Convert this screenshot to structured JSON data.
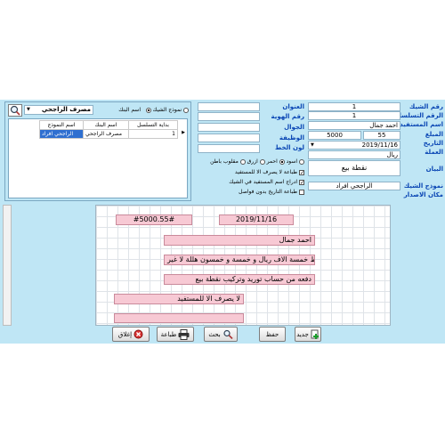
{
  "form": {
    "labels": {
      "cheque_no": "رقم الشيك",
      "serial_no": "الرقم التسلسلي",
      "beneficiary": "اسم المستفيد",
      "amount": "المبلغ",
      "date": "التاريخ",
      "currency": "العملة",
      "statement": "البيان",
      "cheque_template": "نموذج الشيك",
      "issue_place": "مكان الاصدار",
      "address": "العنوان",
      "id_no": "رقم الهوية",
      "mobile": "الجوال",
      "job": "الوظيفة",
      "line_color": "لون الخط"
    },
    "values": {
      "cheque_no": "1",
      "serial_no": "1",
      "beneficiary": "احمد جمال",
      "amount": "5000",
      "amount_fraction": "55",
      "date": "2019/11/16",
      "currency": "ريال",
      "statement": "نقطة بيع",
      "template": "الراجحي افراد"
    },
    "options": {
      "line_colors": [
        "اسود",
        "احمر",
        "ازرق",
        "مقلوب باطن"
      ],
      "checks": [
        "طباعة لا يصرف الا للمستفيد",
        "ادراج اسم المستفيد في الشيك",
        "طباعة التاريخ بدون فواصل"
      ]
    },
    "bank_panel": {
      "bank_select": "مصرف الراجحي",
      "radio_template": "نموذج الشيك",
      "radio_bank": "اسم البنك",
      "columns": [
        "اسم النموذج",
        "اسم البنك",
        "بداية التسلسل"
      ],
      "rows": [
        [
          "الراجحي افراد",
          "مصرف الراجحي",
          "1"
        ]
      ]
    }
  },
  "preview": {
    "amount_box": "#5000.55#",
    "date_box": "2019/11/16",
    "payee": "احمد جمال",
    "amount_words": "فقط خمسة الاف ريال و خمسة و خمسون هللة لا غير",
    "memo": "دفعه من حساب توريد وتركيب نقطة بيع",
    "crossing": "لا يصرف الا للمستفيد"
  },
  "toolbar": {
    "new": "جديد",
    "save": "حفظ",
    "search": "بحث",
    "print": "طباعة",
    "close": "إغلاق"
  },
  "colors": {
    "background": "#bfe6f5",
    "label": "#0a46b4",
    "preview_field": "#f7c9d4"
  }
}
